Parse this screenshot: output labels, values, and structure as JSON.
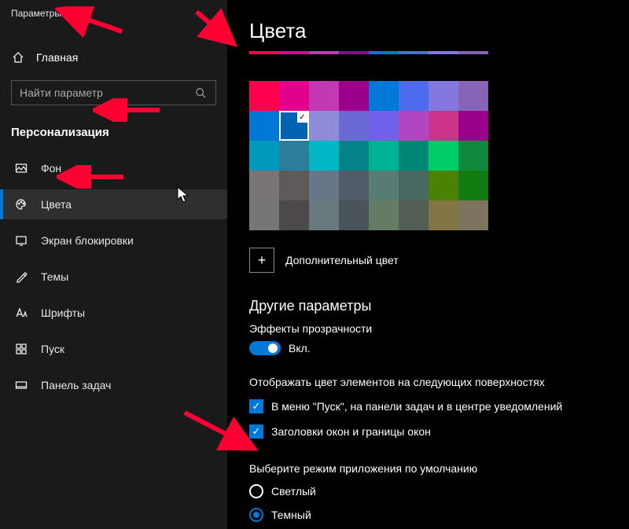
{
  "window": {
    "title": "Параметры"
  },
  "sidebar": {
    "home_label": "Главная",
    "search_placeholder": "Найти параметр",
    "section_title": "Персонализация",
    "items": [
      {
        "label": "Фон"
      },
      {
        "label": "Цвета"
      },
      {
        "label": "Экран блокировки"
      },
      {
        "label": "Темы"
      },
      {
        "label": "Шрифты"
      },
      {
        "label": "Пуск"
      },
      {
        "label": "Панель задач"
      }
    ]
  },
  "content": {
    "heading": "Цвета",
    "color_rows": [
      [
        "#ff004c",
        "#e3008c",
        "#c239b3",
        "#9a0089",
        "#0078d7",
        "#4f6bed",
        "#8378de",
        "#8764b8"
      ],
      [
        "#0078d7",
        "#0063b1",
        "#8e8cd8",
        "#6b69d6",
        "#7160e8",
        "#b146c2",
        "#cc338b",
        "#9b008a"
      ],
      [
        "#0099bc",
        "#2d7d9a",
        "#00b7c3",
        "#038387",
        "#00b294",
        "#018574",
        "#00cc6a",
        "#10893e"
      ],
      [
        "#7a7574",
        "#5d5a58",
        "#68768a",
        "#515c6b",
        "#567c73",
        "#486860",
        "#498205",
        "#107c10"
      ],
      [
        "#767676",
        "#4c4a48",
        "#69797e",
        "#4a5459",
        "#647c64",
        "#525e54",
        "#847545",
        "#7e735f"
      ]
    ],
    "selected_color": {
      "row": 1,
      "col": 1
    },
    "custom_color_label": "Дополнительный цвет",
    "other_params_heading": "Другие параметры",
    "transparency_label": "Эффекты прозрачности",
    "transparency_value": "Вкл.",
    "surfaces_title": "Отображать цвет элементов на следующих поверхностях",
    "surfaces": [
      {
        "label": "В меню \"Пуск\", на панели задач и в центре уведомлений",
        "checked": true
      },
      {
        "label": "Заголовки окон и границы окон",
        "checked": true
      }
    ],
    "mode_title": "Выберите режим приложения по умолчанию",
    "modes": [
      {
        "label": "Светлый",
        "checked": false
      },
      {
        "label": "Темный",
        "checked": true
      }
    ]
  },
  "accent_color": "#0078d7",
  "annotation_color": "#ff0033"
}
